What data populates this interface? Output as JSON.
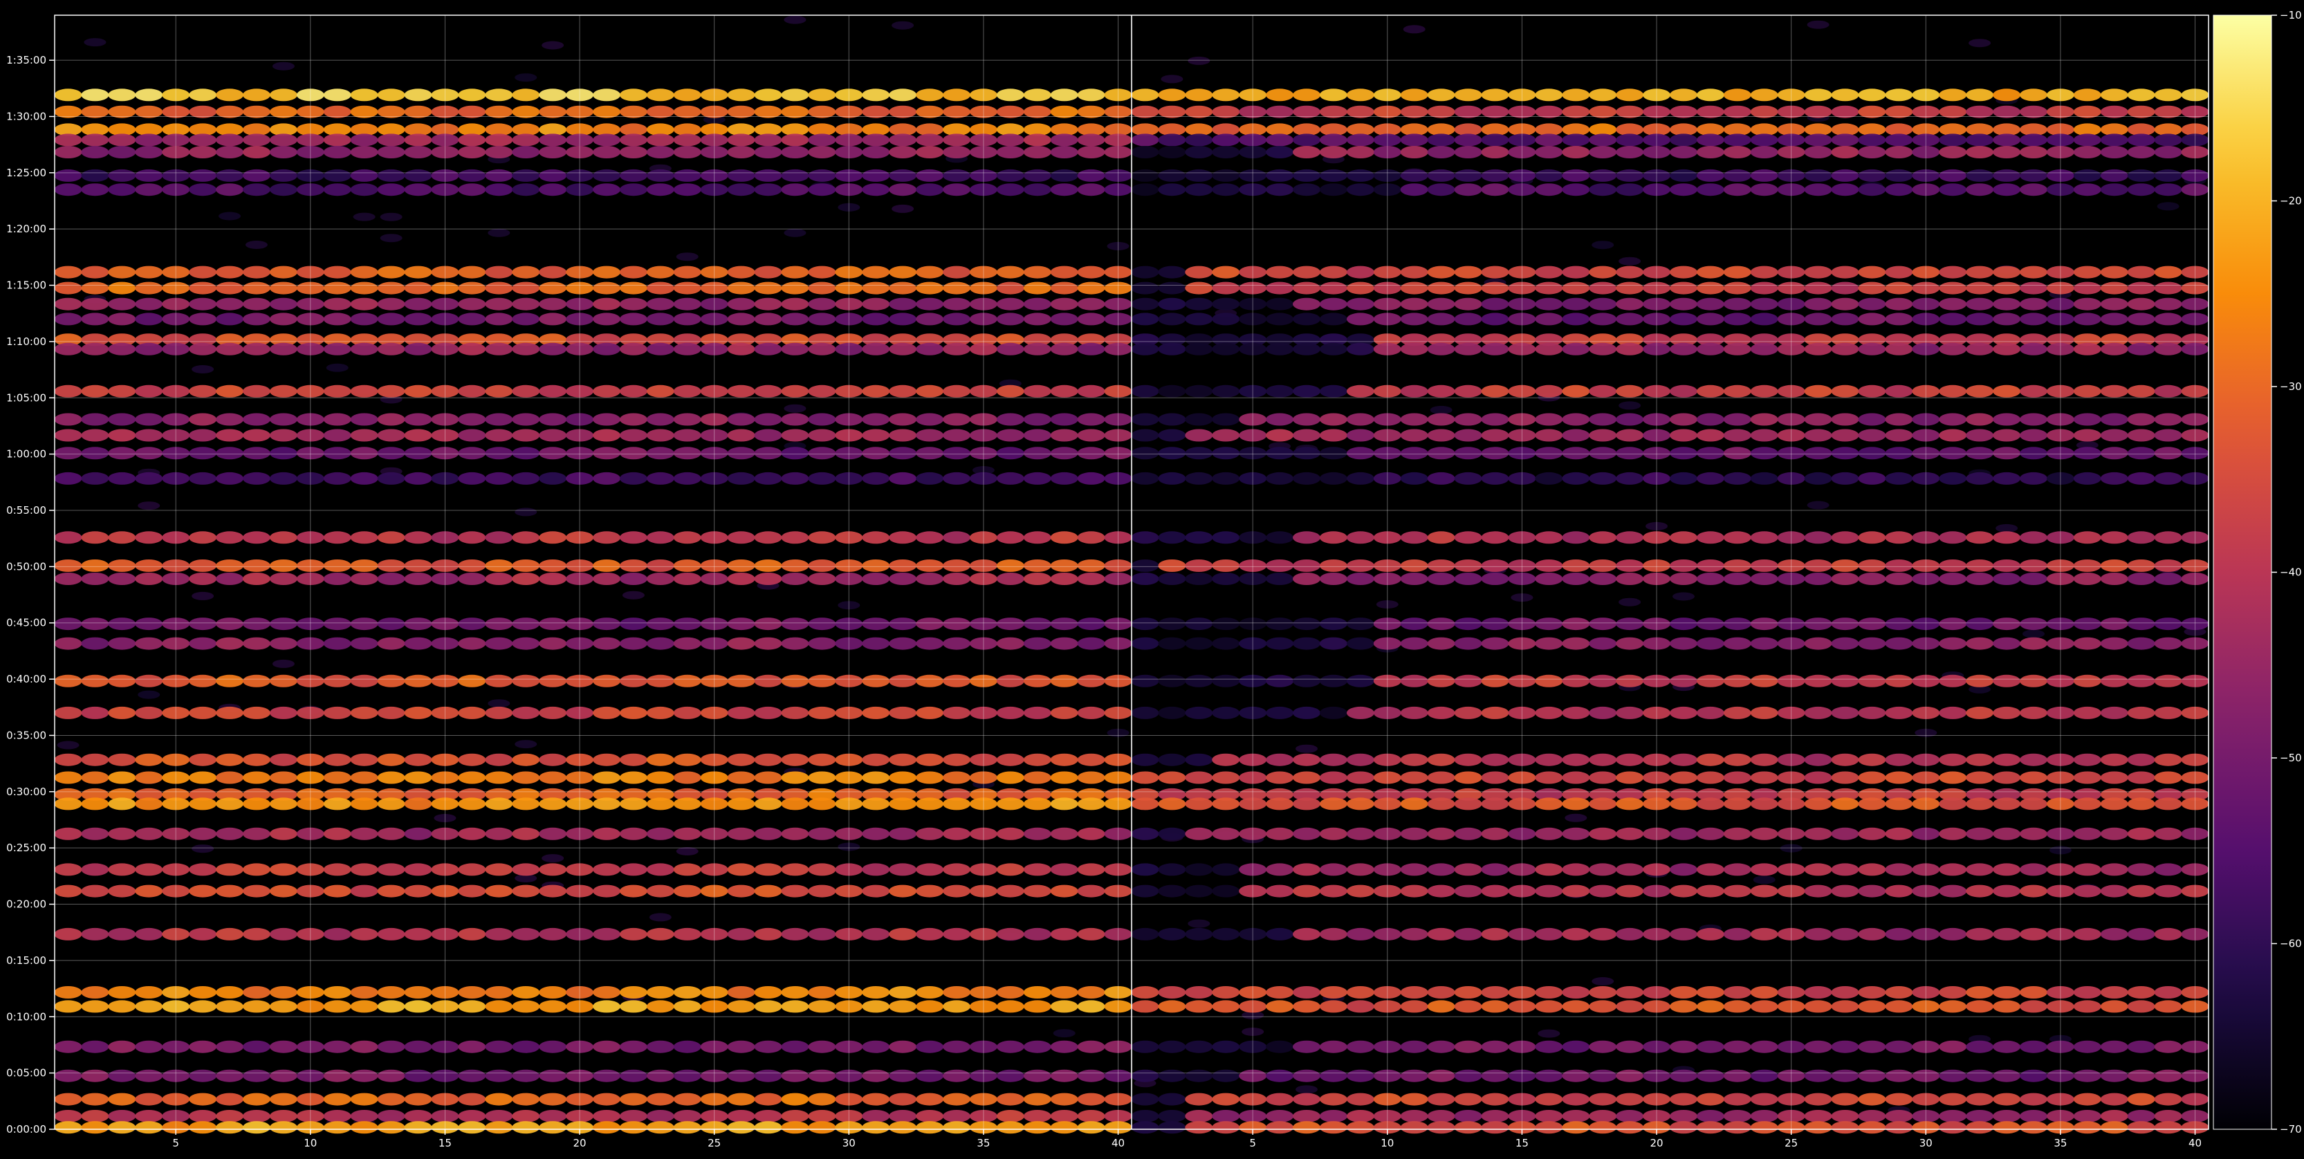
{
  "chart_data": {
    "type": "heatmap",
    "title": "",
    "xlabel": "",
    "ylabel": "",
    "grid": true,
    "colormap": "inferno",
    "panels": [
      {
        "name": "",
        "x_range": [
          1,
          40
        ],
        "x_ticks": [
          5,
          10,
          15,
          20,
          25,
          30,
          35,
          40
        ],
        "x_tick_labels": [
          "5",
          "10",
          "15",
          "20",
          "25",
          "30",
          "35",
          "40"
        ]
      },
      {
        "name": "",
        "x_range": [
          1,
          40
        ],
        "x_ticks": [
          5,
          10,
          15,
          20,
          25,
          30,
          35,
          40
        ],
        "x_tick_labels": [
          "5",
          "10",
          "15",
          "20",
          "25",
          "30",
          "35",
          "40"
        ]
      }
    ],
    "y_axis": {
      "unit": "elapsed time (h:mm:ss)",
      "range_seconds": [
        0,
        5940
      ],
      "ticks_seconds": [
        0,
        300,
        600,
        900,
        1200,
        1500,
        1800,
        2100,
        2400,
        2700,
        3000,
        3300,
        3600,
        3900,
        4200,
        4500,
        4800,
        5100,
        5400,
        5700
      ],
      "tick_labels": [
        "0:00:00",
        "0:05:00",
        "0:10:00",
        "0:15:00",
        "0:20:00",
        "0:25:00",
        "0:30:00",
        "0:35:00",
        "0:40:00",
        "0:45:00",
        "0:50:00",
        "0:55:00",
        "1:00:00",
        "1:05:00",
        "1:10:00",
        "1:15:00",
        "1:20:00",
        "1:25:00",
        "1:30:00",
        "1:35:00"
      ]
    },
    "colorbar": {
      "range": [
        -70,
        -10
      ],
      "ticks": [
        -10,
        -20,
        -30,
        -40,
        -50,
        -60,
        -70
      ],
      "tick_labels": [
        "−10",
        "−20",
        "−30",
        "−40",
        "−50",
        "−60",
        "−70"
      ]
    },
    "bands": [
      {
        "t": 5515,
        "left": -17,
        "right": -20,
        "fade_in": 0
      },
      {
        "t": 5425,
        "left": -30,
        "right": -38,
        "fade_in": 0
      },
      {
        "t": 5330,
        "left": -26,
        "right": -30,
        "fade_in": 0
      },
      {
        "t": 5275,
        "left": -43,
        "right": -55,
        "fade_in": 0
      },
      {
        "t": 5210,
        "left": -46,
        "right": -45,
        "fade_in": 6
      },
      {
        "t": 5085,
        "left": -57,
        "right": -58,
        "fade_in": 10
      },
      {
        "t": 5010,
        "left": -55,
        "right": -55,
        "fade_in": 10
      },
      {
        "t": 4570,
        "left": -31,
        "right": -36,
        "fade_in": 2
      },
      {
        "t": 4485,
        "left": -30,
        "right": -38,
        "fade_in": 2
      },
      {
        "t": 4400,
        "left": -46,
        "right": -48,
        "fade_in": 6
      },
      {
        "t": 4320,
        "left": -50,
        "right": -52,
        "fade_in": 8
      },
      {
        "t": 4210,
        "left": -34,
        "right": -38,
        "fade_in": 9
      },
      {
        "t": 4160,
        "left": -45,
        "right": -45,
        "fade_in": 9
      },
      {
        "t": 3935,
        "left": -36,
        "right": -37,
        "fade_in": 8
      },
      {
        "t": 3785,
        "left": -47,
        "right": -47,
        "fade_in": 4
      },
      {
        "t": 3700,
        "left": -43,
        "right": -44,
        "fade_in": 2
      },
      {
        "t": 3605,
        "left": -51,
        "right": -52,
        "fade_in": 8
      },
      {
        "t": 3470,
        "left": -58,
        "right": -60,
        "fade_in": 8
      },
      {
        "t": 3155,
        "left": -39,
        "right": -41,
        "fade_in": 6
      },
      {
        "t": 3005,
        "left": -32,
        "right": -38,
        "fade_in": 1
      },
      {
        "t": 2935,
        "left": -43,
        "right": -47,
        "fade_in": 6
      },
      {
        "t": 2695,
        "left": -50,
        "right": -50,
        "fade_in": 9
      },
      {
        "t": 2590,
        "left": -47,
        "right": -47,
        "fade_in": 9
      },
      {
        "t": 2390,
        "left": -32,
        "right": -38,
        "fade_in": 9
      },
      {
        "t": 2220,
        "left": -36,
        "right": -40,
        "fade_in": 8
      },
      {
        "t": 1970,
        "left": -33,
        "right": -40,
        "fade_in": 3
      },
      {
        "t": 1875,
        "left": -27,
        "right": -36,
        "fade_in": 0
      },
      {
        "t": 1785,
        "left": -30,
        "right": -38,
        "fade_in": 0
      },
      {
        "t": 1735,
        "left": -24,
        "right": -33,
        "fade_in": 0
      },
      {
        "t": 1575,
        "left": -43,
        "right": -44,
        "fade_in": 2
      },
      {
        "t": 1385,
        "left": -38,
        "right": -43,
        "fade_in": 4
      },
      {
        "t": 1270,
        "left": -34,
        "right": -40,
        "fade_in": 4
      },
      {
        "t": 1040,
        "left": -40,
        "right": -43,
        "fade_in": 6
      },
      {
        "t": 730,
        "left": -26,
        "right": -36,
        "fade_in": 0
      },
      {
        "t": 655,
        "left": -22,
        "right": -33,
        "fade_in": 0
      },
      {
        "t": 440,
        "left": -49,
        "right": -50,
        "fade_in": 6
      },
      {
        "t": 285,
        "left": -50,
        "right": -50,
        "fade_in": 4
      },
      {
        "t": 160,
        "left": -30,
        "right": -36,
        "fade_in": 2
      },
      {
        "t": 70,
        "left": -40,
        "right": -44,
        "fade_in": 2
      },
      {
        "t": 10,
        "left": -22,
        "right": -33,
        "fade_in": 2
      }
    ]
  }
}
